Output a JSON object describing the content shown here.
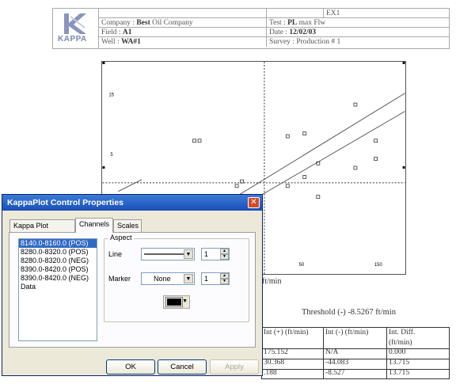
{
  "header": {
    "ex_label": "EX1",
    "logo_text": "KAPPA",
    "company_label": "Company :",
    "company_value": "Best",
    "company_suffix": "Oil Company",
    "test_label": "Test :",
    "test_value": "PL",
    "test_suffix": "max Flw",
    "field_label": "Field :",
    "field_value": "A1",
    "date_label": "Date :",
    "date_value": "12/02/03",
    "well_label": "Well :",
    "well_value": "WA#1",
    "survey_label": "Survey :",
    "survey_value": "Production # 1"
  },
  "chart_data": {
    "type": "scatter",
    "y_tick_labels": [
      "15",
      "5"
    ],
    "x_tick_labels": [
      "50",
      "150"
    ],
    "x_unit_label": "ft/min",
    "points": [
      [
        10,
        4
      ],
      [
        20,
        5
      ],
      [
        70,
        2
      ],
      [
        70,
        8
      ],
      [
        73,
        8.5
      ],
      [
        75,
        1.5
      ],
      [
        45,
        13
      ],
      [
        48,
        13
      ],
      [
        100,
        8
      ],
      [
        100,
        13.5
      ],
      [
        110,
        9
      ],
      [
        110,
        13.8
      ],
      [
        118,
        6.8
      ],
      [
        118,
        10.5
      ],
      [
        140,
        10
      ],
      [
        140,
        17
      ],
      [
        152,
        11
      ],
      [
        152,
        13
      ]
    ]
  },
  "threshold_text": "Threshold (-)  -8.5267 ft/min",
  "dialog": {
    "title": "KappaPlot Control Properties",
    "close_symbol": "✕",
    "tabs": [
      "Kappa Plot Control",
      "Channels",
      "Scales"
    ],
    "list_items": [
      "8140.0-8160.0 (POS)",
      "8280.0-8320.0 (POS)",
      "8280.0-8320.0 (NEG)",
      "8390.0-8420.0 (POS)",
      "8390.0-8420.0 (NEG)",
      "Data"
    ],
    "aspect_label": "Aspect",
    "line_label": "Line",
    "line_spin": "1",
    "marker_label": "Marker",
    "marker_value": "None",
    "marker_spin": "1",
    "color_value": "#000000",
    "ok_label": "OK",
    "cancel_label": "Cancel",
    "apply_label": "Apply"
  },
  "table": {
    "headers": [
      "Int (+)  (ft/min)",
      "Int (-)  (ft/min)",
      "Int. Diff.",
      "(ft/min)"
    ],
    "rows": [
      [
        "175.152",
        "N/A",
        "0.000"
      ],
      [
        "30.368",
        "-44.083",
        "13.715"
      ],
      [
        ".188",
        "-8.527",
        "13.715"
      ]
    ]
  }
}
